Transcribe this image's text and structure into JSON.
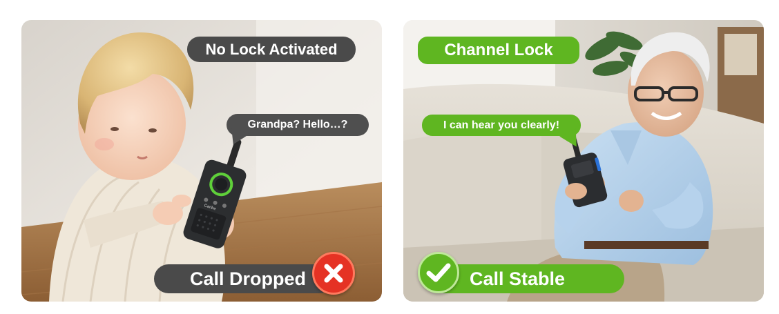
{
  "left_panel": {
    "status_label": "No Lock Activated",
    "speech_text": "Grandpa? Hello…?",
    "result_label": "Call Dropped",
    "result_icon": "x-mark-icon",
    "device_brand": "Caribe",
    "accent_color": "#e53224",
    "label_color": "#4a4a4a"
  },
  "right_panel": {
    "status_label": "Channel Lock",
    "speech_text": "I can hear you clearly!",
    "result_label": "Call Stable",
    "result_icon": "check-mark-icon",
    "accent_color": "#5fb621"
  }
}
